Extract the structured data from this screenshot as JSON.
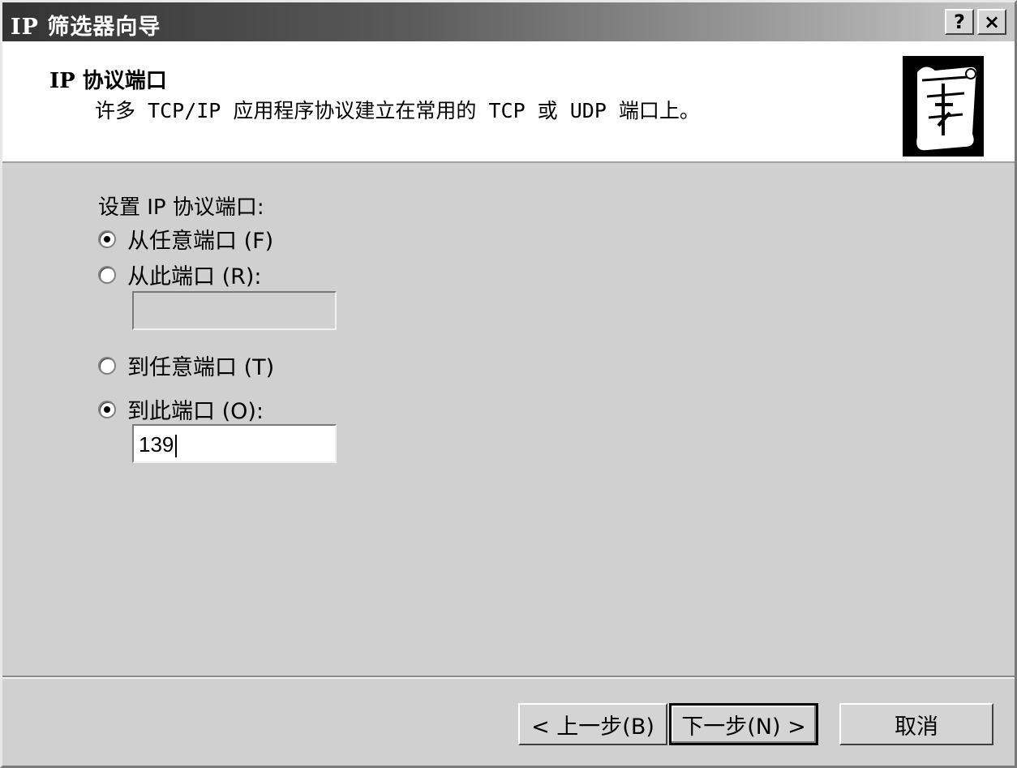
{
  "window": {
    "title": "IP 筛选器向导",
    "help_label": "?",
    "close_label": "×"
  },
  "header": {
    "title": "IP 协议端口",
    "subtitle": "许多 TCP/IP 应用程序协议建立在常用的 TCP 或 UDP 端口上。",
    "icon": "wizard-scroll-icon"
  },
  "form": {
    "group_label": "设置 IP 协议端口:",
    "options": [
      {
        "label": "从任意端口 (F)",
        "checked": true
      },
      {
        "label": "从此端口 (R):",
        "checked": false
      },
      {
        "label": "到任意端口 (T)",
        "checked": false
      },
      {
        "label": "到此端口 (O):",
        "checked": true
      }
    ],
    "from_port_value": "",
    "to_port_value": "139"
  },
  "buttons": {
    "back": "< 上一步(B)",
    "next": "下一步(N) >",
    "cancel": "取消"
  }
}
